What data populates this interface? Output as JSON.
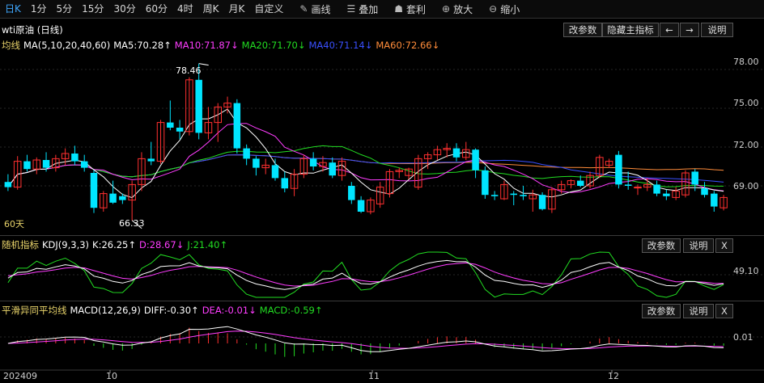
{
  "toolbar": {
    "periods": [
      "日K",
      "1分",
      "5分",
      "15分",
      "30分",
      "60分",
      "4时",
      "周K",
      "月K",
      "自定义"
    ],
    "active_period": "日K",
    "tools": [
      {
        "label": "画线",
        "icon": "pencil-icon"
      },
      {
        "label": "叠加",
        "icon": "layers-icon"
      },
      {
        "label": "套利",
        "icon": "moneybag-icon"
      },
      {
        "label": "放大",
        "icon": "zoom-in-icon"
      },
      {
        "label": "缩小",
        "icon": "zoom-out-icon"
      }
    ]
  },
  "main_panel": {
    "title": "wti原油 (日线)",
    "buttons": {
      "params": "改参数",
      "hide": "隐藏主指标",
      "prev": "←",
      "next": "→",
      "help": "说明"
    },
    "ma_header": {
      "name": "均线",
      "params": "MA(5,10,20,40,60)",
      "ma5": "MA5:70.28↑",
      "ma10": "MA10:71.87↓",
      "ma20": "MA20:71.70↓",
      "ma40": "MA40:71.14↓",
      "ma60": "MA60:72.66↓"
    },
    "y_ticks": [
      "78.00",
      "75.00",
      "72.00",
      "69.00"
    ],
    "high_label": "78.46",
    "low_label": "66.33",
    "days_label": "60天"
  },
  "kdj_panel": {
    "name": "随机指标",
    "params": "KDJ(9,3,3)",
    "k": "K:26.25↑",
    "d": "D:28.67↓",
    "j": "J:21.40↑",
    "buttons": {
      "params": "改参数",
      "help": "说明",
      "close": "X"
    },
    "y_tick": "49.10"
  },
  "macd_panel": {
    "name": "平滑异同平均线",
    "params": "MACD(12,26,9)",
    "diff": "DIFF:-0.30↑",
    "dea": "DEA:-0.01↓",
    "macd": "MACD:-0.59↑",
    "buttons": {
      "params": "改参数",
      "help": "说明",
      "close": "X"
    },
    "y_tick": "0.01"
  },
  "x_axis": [
    "202409",
    "10",
    "11",
    "12"
  ],
  "colors": {
    "up": "#ff3030",
    "down": "#00e5ff",
    "ma5": "#ffffff",
    "ma10": "#ff3dff",
    "ma20": "#22dd22",
    "ma40": "#3a50ff",
    "ma60": "#ff8c3a",
    "k": "#ffffff",
    "d": "#ff3dff",
    "j": "#22dd22",
    "header_yellow": "#e8d36a",
    "accent": "#3fa8ff"
  },
  "chart_data": {
    "type": "candlestick",
    "y_range": [
      65.5,
      79.5
    ],
    "candles": [
      [
        69.3,
        69.9,
        68.6,
        68.9
      ],
      [
        68.9,
        71.3,
        68.7,
        70.9
      ],
      [
        70.9,
        71.4,
        70.1,
        70.3
      ],
      [
        70.3,
        71.2,
        69.9,
        71.0
      ],
      [
        71.0,
        71.6,
        70.1,
        70.4
      ],
      [
        70.4,
        71.4,
        70.1,
        71.1
      ],
      [
        71.1,
        71.9,
        70.6,
        71.5
      ],
      [
        71.5,
        72.1,
        70.6,
        70.9
      ],
      [
        70.9,
        71.4,
        70.1,
        70.4
      ],
      [
        70.0,
        70.2,
        66.9,
        67.3
      ],
      [
        67.3,
        68.6,
        67.0,
        68.4
      ],
      [
        68.4,
        69.4,
        67.6,
        67.7
      ],
      [
        68.2,
        68.4,
        67.6,
        67.9
      ],
      [
        67.9,
        69.4,
        66.33,
        69.1
      ],
      [
        69.1,
        71.6,
        68.6,
        71.1
      ],
      [
        71.1,
        72.4,
        70.6,
        70.9
      ],
      [
        70.9,
        74.1,
        70.7,
        73.9
      ],
      [
        73.9,
        75.6,
        73.3,
        73.5
      ],
      [
        73.5,
        74.1,
        72.6,
        73.2
      ],
      [
        73.2,
        77.4,
        72.9,
        77.2
      ],
      [
        77.2,
        78.46,
        72.6,
        73.1
      ],
      [
        73.1,
        75.1,
        72.6,
        73.9
      ],
      [
        73.9,
        75.4,
        72.4,
        75.1
      ],
      [
        75.1,
        75.9,
        74.6,
        75.4
      ],
      [
        75.4,
        75.7,
        71.5,
        71.9
      ],
      [
        71.9,
        72.2,
        70.6,
        71.1
      ],
      [
        71.1,
        71.3,
        69.8,
        70.4
      ],
      [
        70.4,
        71.1,
        69.9,
        70.6
      ],
      [
        70.6,
        71.1,
        69.4,
        69.6
      ],
      [
        69.6,
        70.1,
        68.5,
        68.8
      ],
      [
        68.8,
        70.3,
        68.2,
        69.9
      ],
      [
        69.9,
        71.4,
        69.6,
        71.1
      ],
      [
        71.1,
        71.6,
        70.2,
        70.5
      ],
      [
        70.5,
        71.3,
        70.1,
        70.8
      ],
      [
        70.8,
        71.2,
        69.6,
        69.8
      ],
      [
        69.8,
        71.2,
        69.4,
        70.9
      ],
      [
        69.0,
        69.3,
        67.6,
        67.9
      ],
      [
        67.9,
        68.2,
        66.9,
        67.0
      ],
      [
        67.0,
        68.1,
        66.8,
        67.9
      ],
      [
        67.6,
        69.3,
        67.3,
        68.9
      ],
      [
        68.4,
        70.3,
        68.1,
        70.1
      ],
      [
        70.1,
        70.4,
        69.6,
        70.2
      ],
      [
        69.8,
        70.4,
        69.5,
        70.3
      ],
      [
        68.9,
        71.4,
        68.7,
        71.1
      ],
      [
        71.1,
        71.6,
        70.3,
        71.4
      ],
      [
        71.4,
        72.1,
        71.0,
        71.8
      ],
      [
        71.8,
        72.3,
        71.2,
        71.9
      ],
      [
        71.9,
        72.3,
        70.9,
        71.2
      ],
      [
        71.2,
        72.4,
        71.0,
        71.8
      ],
      [
        71.8,
        71.9,
        69.6,
        70.2
      ],
      [
        70.2,
        70.5,
        68.0,
        68.3
      ],
      [
        68.3,
        68.6,
        67.9,
        68.2
      ],
      [
        68.0,
        69.4,
        67.9,
        69.1
      ],
      [
        68.4,
        68.6,
        67.5,
        68.3
      ],
      [
        68.3,
        69.0,
        67.9,
        68.2
      ],
      [
        68.0,
        68.7,
        67.0,
        68.3
      ],
      [
        68.3,
        68.5,
        67.1,
        67.2
      ],
      [
        67.2,
        68.9,
        66.9,
        68.7
      ],
      [
        68.7,
        69.4,
        68.4,
        69.1
      ],
      [
        69.1,
        69.5,
        68.8,
        69.4
      ],
      [
        69.4,
        69.8,
        68.9,
        69.0
      ],
      [
        69.0,
        70.1,
        68.8,
        69.8
      ],
      [
        69.8,
        71.4,
        69.6,
        71.2
      ],
      [
        70.6,
        71.1,
        70.4,
        70.9
      ],
      [
        71.4,
        71.7,
        68.8,
        69.1
      ],
      [
        69.1,
        70.1,
        68.7,
        69.0
      ],
      [
        68.9,
        69.1,
        68.3,
        68.9
      ],
      [
        68.9,
        69.6,
        68.6,
        69.1
      ],
      [
        69.1,
        69.4,
        68.2,
        68.4
      ],
      [
        68.4,
        68.7,
        67.9,
        68.2
      ],
      [
        68.1,
        68.9,
        67.9,
        68.6
      ],
      [
        68.3,
        70.2,
        68.1,
        70.0
      ],
      [
        70.1,
        70.3,
        68.6,
        69.1
      ],
      [
        68.8,
        69.3,
        68.1,
        68.3
      ],
      [
        68.4,
        68.6,
        67.0,
        67.4
      ],
      [
        67.3,
        68.3,
        67.1,
        68.1
      ]
    ],
    "ma_values": {
      "ma5": 70.28,
      "ma10": 71.87,
      "ma20": 71.7,
      "ma40": 71.14,
      "ma60": 72.66
    },
    "kdj": {
      "k": 26.25,
      "d": 28.67,
      "j": 21.4
    },
    "macd": {
      "diff": -0.3,
      "dea": -0.01,
      "macd": -0.59
    }
  }
}
